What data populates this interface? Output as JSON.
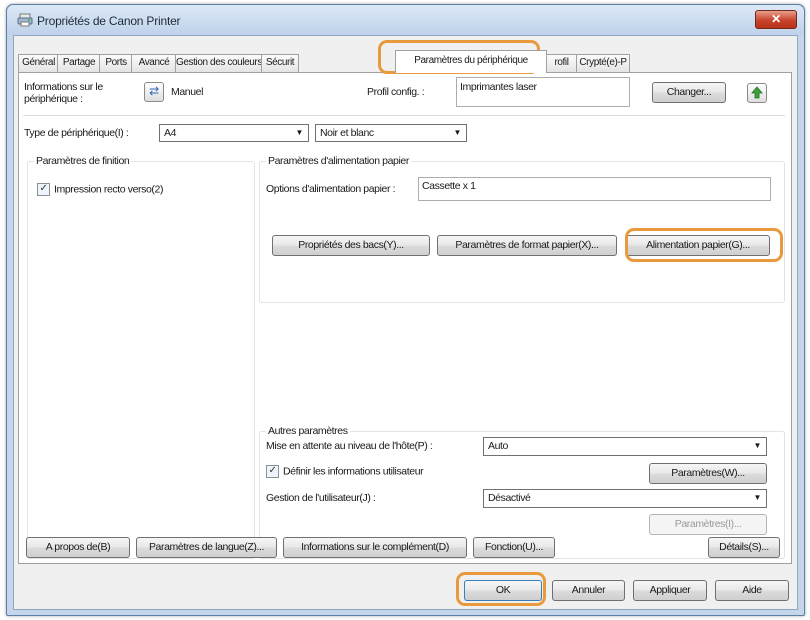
{
  "window": {
    "title": "Propriétés de Canon Printer",
    "close_glyph": "✕"
  },
  "tabs": [
    {
      "label": "Général"
    },
    {
      "label": "Partage"
    },
    {
      "label": "Ports"
    },
    {
      "label": "Avancé"
    },
    {
      "label": "Gestion des couleurs"
    },
    {
      "label": "Sécurit"
    },
    {
      "label": "Paramètres du périphérique"
    },
    {
      "label": "rofil"
    },
    {
      "label": "Crypté(e)-P"
    }
  ],
  "device_info": {
    "label_line1": "Informations sur le",
    "label_line2": "périphérique :",
    "mode": "Manuel",
    "profile_label": "Profil config. :",
    "profile_value": "Imprimantes laser",
    "change_button": "Changer..."
  },
  "device_type": {
    "label": "Type de périphérique(I) :",
    "paper_value": "A4",
    "color_value": "Noir et blanc"
  },
  "finishing": {
    "title": "Paramètres de finition",
    "duplex_label": "Impression recto verso(2)",
    "duplex_checked": true
  },
  "paper_feed": {
    "title": "Paramètres d'alimentation papier",
    "options_label": "Options d'alimentation papier :",
    "options_value": "Cassette x 1",
    "tray_props_button": "Propriétés des bacs(Y)...",
    "paper_format_button": "Paramètres de format papier(X)...",
    "paper_feed_button": "Alimentation papier(G)..."
  },
  "other": {
    "title": "Autres paramètres",
    "hold_label": "Mise en attente au niveau de l'hôte(P) :",
    "hold_value": "Auto",
    "define_user_label": "Définir les informations utilisateur",
    "define_user_checked": true,
    "settings_button": "Paramètres(W)...",
    "user_mgmt_label": "Gestion de l'utilisateur(J) :",
    "user_mgmt_value": "Désactivé",
    "settings2_button": "Paramètres(I)..."
  },
  "footer_buttons": {
    "about": "A propos de(B)",
    "language": "Paramètres de langue(Z)...",
    "plugin_info": "Informations sur le complément(D)",
    "function": "Fonction(U)...",
    "details": "Détails(S)..."
  },
  "dialog_buttons": {
    "ok": "OK",
    "cancel": "Annuler",
    "apply": "Appliquer",
    "help": "Aide"
  },
  "colors": {
    "highlight": "#e89a3c",
    "titlebar": "#c5d6ea",
    "close": "#c7432a"
  },
  "icons": [
    "printer-icon",
    "close-icon",
    "manual-config-icon",
    "upload-arrow-icon",
    "dropdown-arrow-icon",
    "checkbox-icon"
  ]
}
